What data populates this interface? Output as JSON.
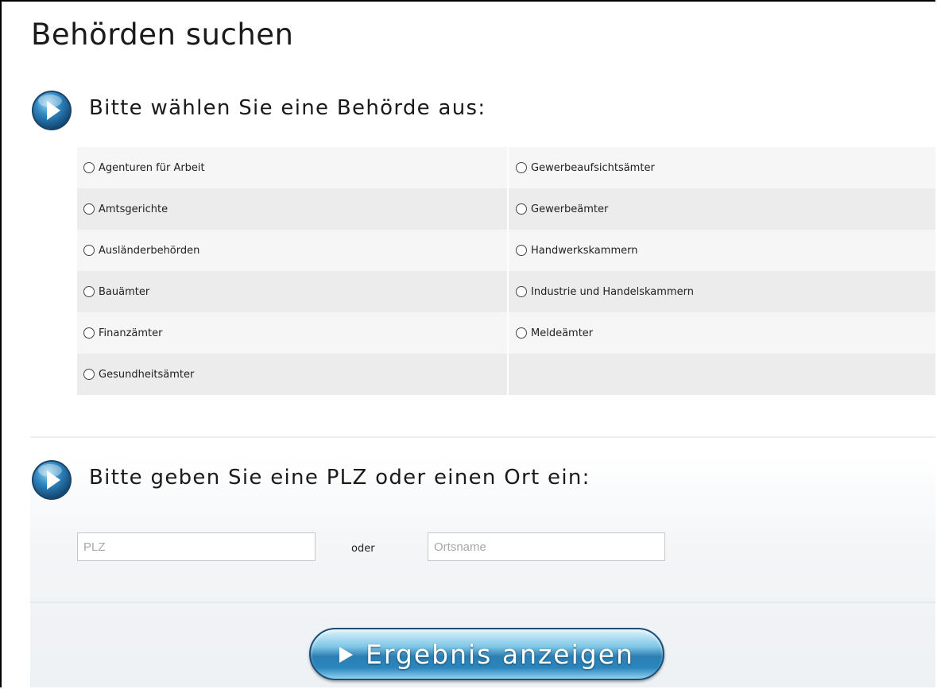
{
  "page": {
    "title": "Behörden suchen"
  },
  "section_authority": {
    "heading": "Bitte wählen Sie eine Behörde aus:",
    "icon": "play-circle-icon",
    "options": [
      [
        "Agenturen für Arbeit",
        "Gewerbeaufsichtsämter"
      ],
      [
        "Amtsgerichte",
        "Gewerbeämter"
      ],
      [
        "Ausländerbehörden",
        "Handwerkskammern"
      ],
      [
        "Bauämter",
        "Industrie und Handelskammern"
      ],
      [
        "Finanzämter",
        "Meldeämter"
      ],
      [
        "Gesundheitsämter",
        ""
      ]
    ]
  },
  "section_location": {
    "heading": "Bitte geben Sie eine PLZ oder einen Ort ein:",
    "icon": "play-circle-icon",
    "plz": {
      "value": "",
      "placeholder": "PLZ"
    },
    "separator": "oder",
    "ort": {
      "value": "",
      "placeholder": "Ortsname"
    }
  },
  "submit": {
    "label": "Ergebnis anzeigen",
    "icon": "play-triangle-icon"
  },
  "colors": {
    "accent": "#2b7fb2",
    "accent_dark": "#1c4f77",
    "row_shade": "#ececec",
    "row_light": "#f6f6f6"
  }
}
